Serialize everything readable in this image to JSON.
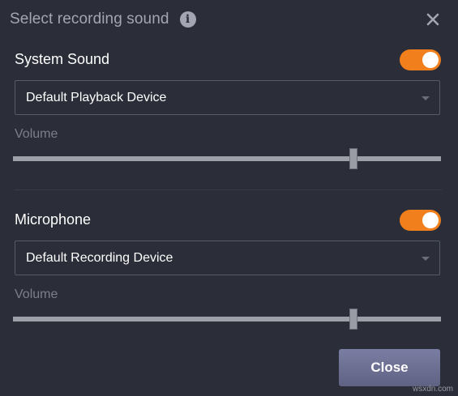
{
  "dialog": {
    "title": "Select recording sound",
    "info_icon": "info-icon",
    "close_icon": "close-icon"
  },
  "system_sound": {
    "label": "System Sound",
    "enabled": true,
    "device": "Default Playback Device",
    "volume_label": "Volume",
    "volume_fraction": 0.795
  },
  "microphone": {
    "label": "Microphone",
    "enabled": true,
    "device": "Default Recording Device",
    "volume_label": "Volume",
    "volume_fraction": 0.795
  },
  "footer": {
    "close_label": "Close"
  },
  "watermark": "wsxdn.com",
  "colors": {
    "toggle_on": "#f07f1c",
    "close_button": "#6e7194",
    "background": "#2b2d38"
  }
}
